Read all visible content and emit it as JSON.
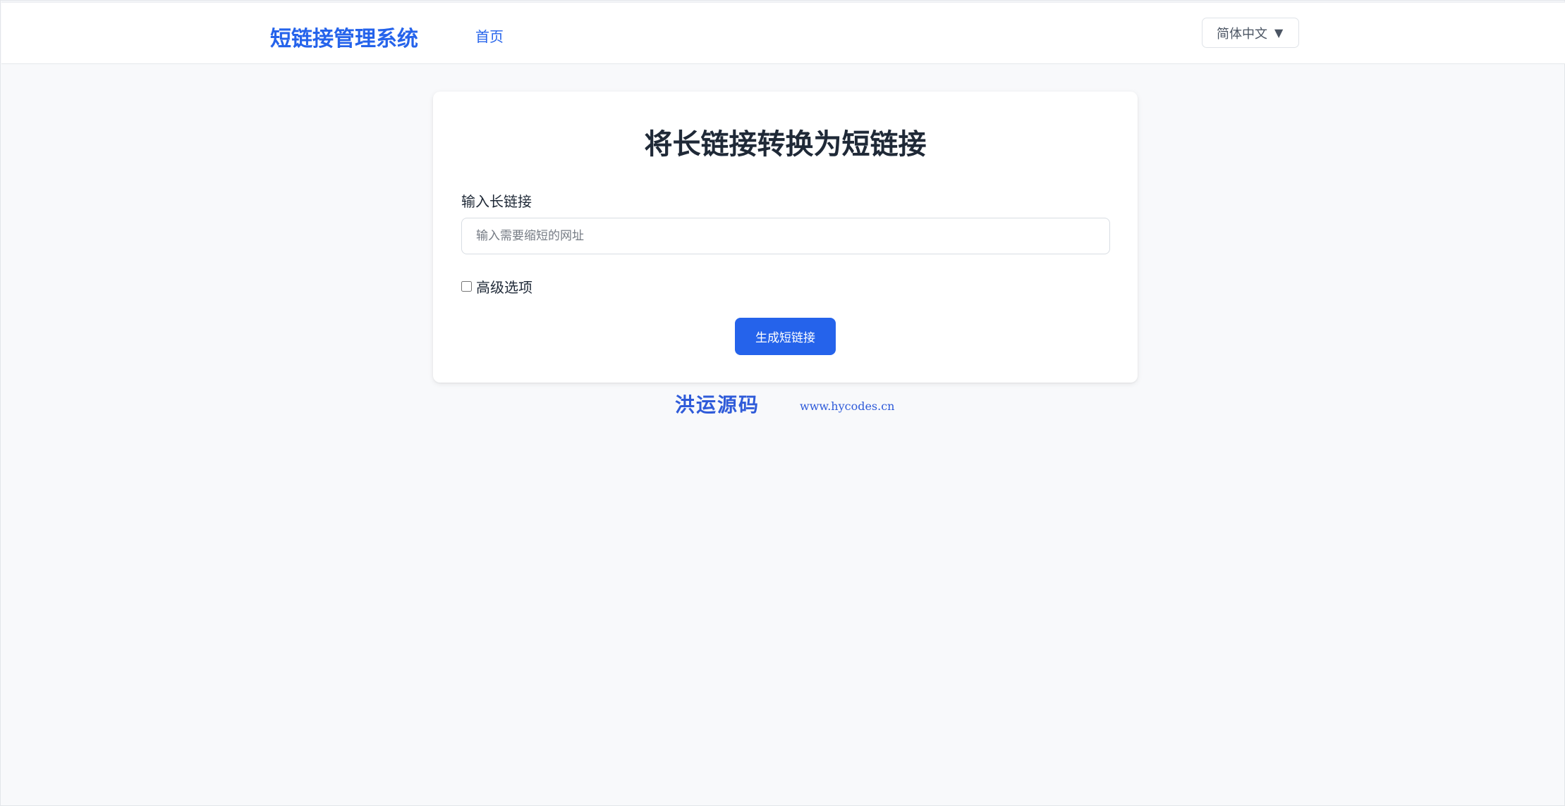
{
  "header": {
    "brand": "短链接管理系统",
    "nav": {
      "home_label": "首页"
    },
    "language": {
      "selected": "简体中文",
      "caret_icon": "▼"
    }
  },
  "main": {
    "title": "将长链接转换为短链接",
    "long_url": {
      "label": "输入长链接",
      "placeholder": "输入需要缩短的网址",
      "value": ""
    },
    "advanced": {
      "label": "高级选项",
      "checked": false
    },
    "submit_label": "生成短链接"
  },
  "footer": {
    "brand": "洪运源码",
    "url": "www.hycodes.cn"
  },
  "colors": {
    "accent": "#2563eb",
    "background": "#f8f9fb",
    "text": "#1f2937"
  }
}
